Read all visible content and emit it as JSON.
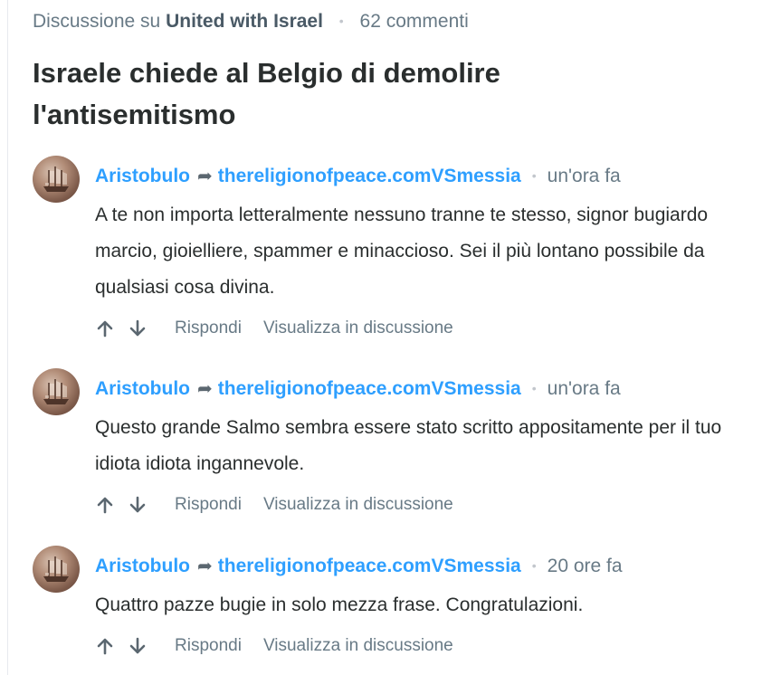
{
  "header": {
    "prefix": "Discussione su",
    "forum": "United with Israel",
    "comment_count": "62 commenti"
  },
  "title": "Israele chiede al Belgio di demolire l'antisemitismo",
  "reply_arrow_icon": "reply-arrow-icon",
  "actions": {
    "reply": "Rispondi",
    "view": "Visualizza in discussione"
  },
  "comments": [
    {
      "author": "Aristobulo",
      "reply_to": "thereligionofpeace.comVSmessia",
      "time": "un'ora fa",
      "text": "A te non importa letteralmente nessuno tranne te stesso, signor bugiardo marcio, gioielliere, spammer e minaccioso. Sei il più lontano possibile da qualsiasi cosa divina."
    },
    {
      "author": "Aristobulo",
      "reply_to": "thereligionofpeace.comVSmessia",
      "time": "un'ora fa",
      "text": "Questo grande Salmo sembra essere stato scritto appositamente per il tuo idiota idiota ingannevole."
    },
    {
      "author": "Aristobulo",
      "reply_to": "thereligionofpeace.comVSmessia",
      "time": "20 ore fa",
      "text": "Quattro pazze bugie in solo mezza frase. Congratulazioni."
    }
  ]
}
